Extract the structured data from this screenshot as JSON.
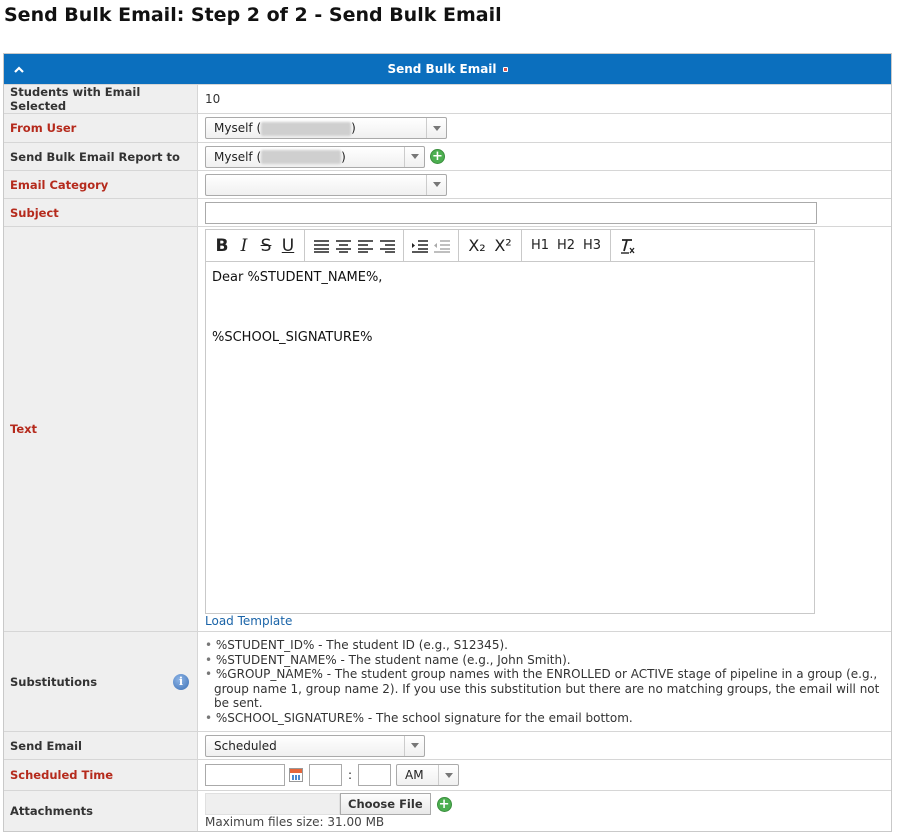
{
  "page": {
    "title": "Send Bulk Email: Step 2 of 2 - Send Bulk Email"
  },
  "panel": {
    "header": "Send Bulk Email"
  },
  "form": {
    "students_selected": {
      "label": "Students with Email Selected",
      "value": "10"
    },
    "from_user": {
      "label": "From User",
      "value_prefix": "Myself (",
      "value_suffix": ")"
    },
    "report_to": {
      "label": "Send Bulk Email Report to",
      "value_prefix": "Myself (",
      "value_suffix": ")"
    },
    "email_category": {
      "label": "Email Category",
      "value": ""
    },
    "subject": {
      "label": "Subject",
      "value": ""
    },
    "text": {
      "label": "Text",
      "toolbar": {
        "bold": "B",
        "italic": "I",
        "strike": "S",
        "underline": "U",
        "subscript": "X₂",
        "superscript": "X²",
        "h1": "H1",
        "h2": "H2",
        "h3": "H3",
        "clear": "Ix"
      },
      "body_line1": "Dear %STUDENT_NAME%,",
      "body_line2": "%SCHOOL_SIGNATURE%",
      "load_template": "Load Template"
    },
    "substitutions": {
      "label": "Substitutions",
      "items": [
        "%STUDENT_ID% - The student ID (e.g., S12345).",
        "%STUDENT_NAME% - The student name (e.g., John Smith).",
        "%GROUP_NAME% - The student group names with the ENROLLED or ACTIVE stage of pipeline in a group (e.g., group name 1, group name 2). If you use this substitution but there are no matching groups, the email will not be sent.",
        "%SCHOOL_SIGNATURE% - The school signature for the email bottom."
      ]
    },
    "send_email": {
      "label": "Send Email",
      "value": "Scheduled"
    },
    "scheduled_time": {
      "label": "Scheduled Time",
      "date": "",
      "hour": "",
      "minute": "",
      "separator": ":",
      "ampm": "AM"
    },
    "attachments": {
      "label": "Attachments",
      "button": "Choose File",
      "note": "Maximum files size: 31.00 MB"
    }
  },
  "colors": {
    "header_bg": "#0b6fbe",
    "required_label": "#b52a1c",
    "link": "#1a64a8",
    "add_icon": "#4caf50"
  }
}
